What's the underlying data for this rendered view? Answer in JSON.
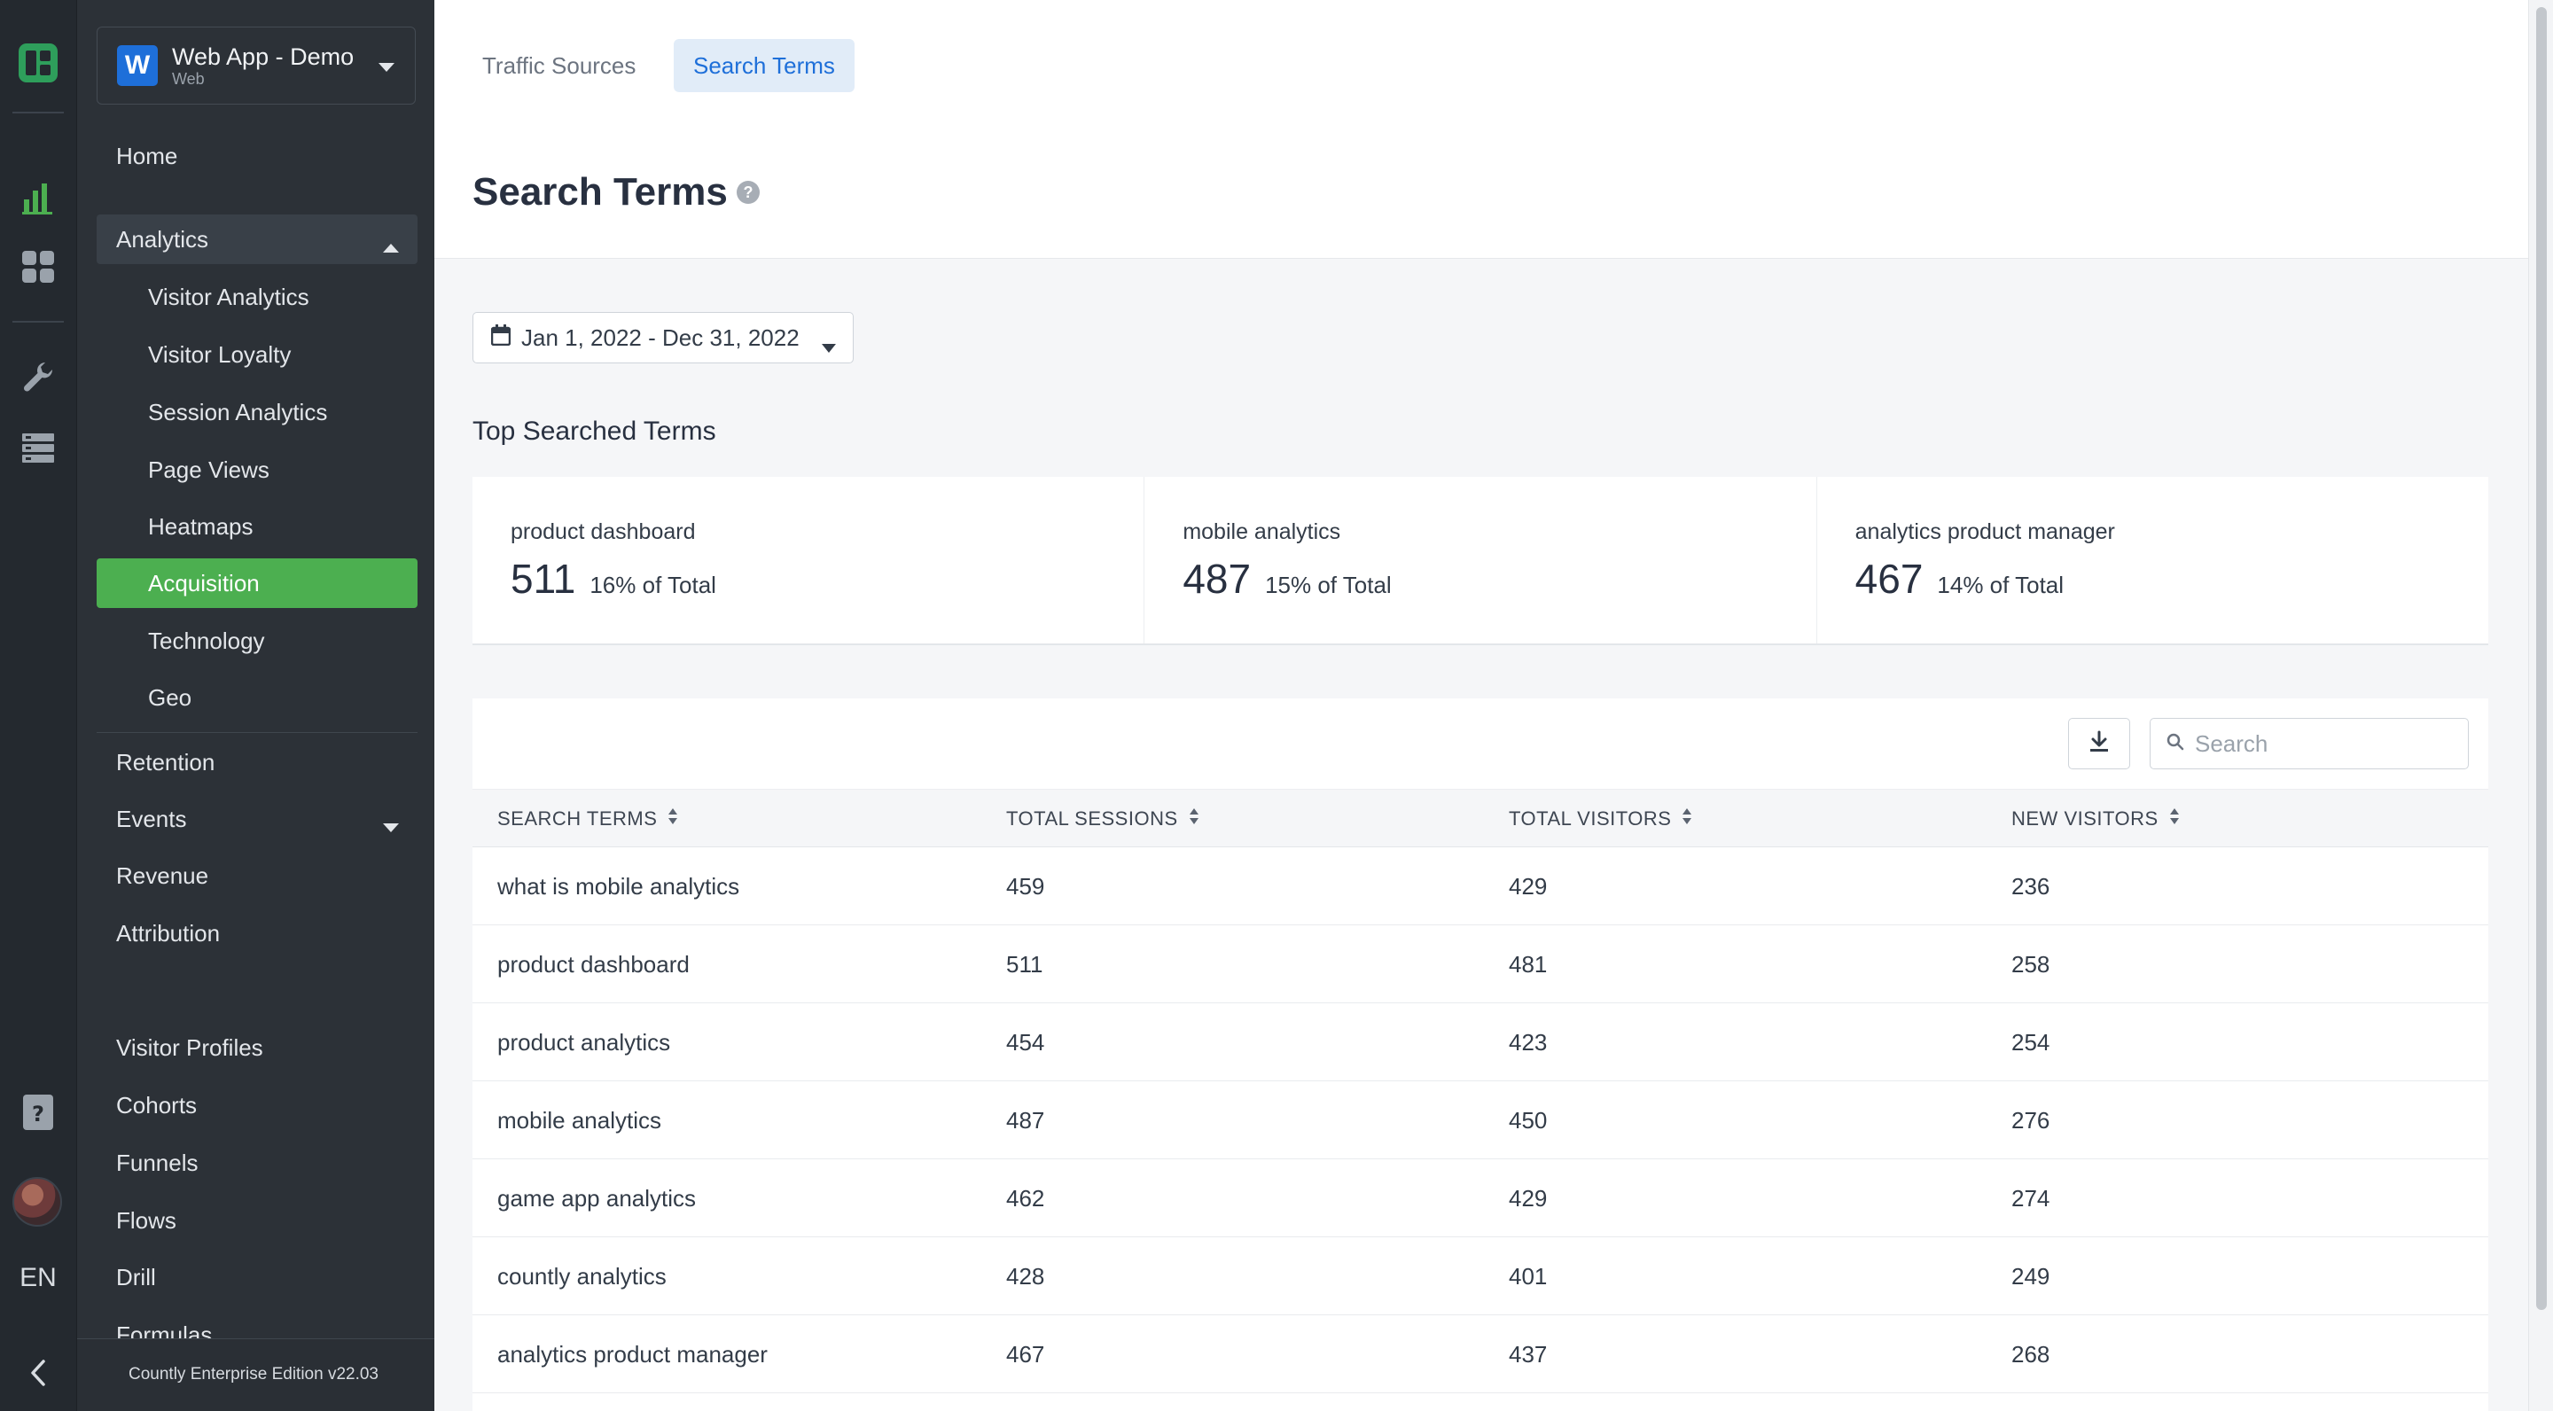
{
  "app": {
    "name": "Web App - Demo",
    "type": "Web",
    "badge": "W",
    "accent": "#4caf50",
    "brand_blue": "#1e6fd9"
  },
  "rail": {
    "icons": [
      "countly-logo-icon",
      "analytics-chart-icon",
      "dashboard-grid-icon",
      "wrench-icon",
      "database-icon",
      "notes-icon",
      "avatar"
    ],
    "language": "EN"
  },
  "sidebar": {
    "items": [
      {
        "label": "Home"
      },
      {
        "label": "Analytics"
      },
      {
        "label": "Visitor Analytics"
      },
      {
        "label": "Visitor Loyalty"
      },
      {
        "label": "Session Analytics"
      },
      {
        "label": "Page Views"
      },
      {
        "label": "Heatmaps"
      },
      {
        "label": "Acquisition"
      },
      {
        "label": "Technology"
      },
      {
        "label": "Geo"
      },
      {
        "label": "Retention"
      },
      {
        "label": "Events"
      },
      {
        "label": "Revenue"
      },
      {
        "label": "Attribution"
      },
      {
        "label": "Visitor Profiles"
      },
      {
        "label": "Cohorts"
      },
      {
        "label": "Funnels"
      },
      {
        "label": "Flows"
      },
      {
        "label": "Drill"
      },
      {
        "label": "Formulas"
      }
    ],
    "active": "Acquisition",
    "version": "Countly Enterprise Edition v22.03"
  },
  "tabs": [
    {
      "label": "Traffic Sources",
      "active": false
    },
    {
      "label": "Search Terms",
      "active": true
    }
  ],
  "page": {
    "title": "Search Terms",
    "help": "?",
    "date_range": "Jan 1, 2022 - Dec 31, 2022",
    "section_title": "Top Searched Terms"
  },
  "top_terms": [
    {
      "term": "product dashboard",
      "value": "511",
      "pct": "16% of Total"
    },
    {
      "term": "mobile analytics",
      "value": "487",
      "pct": "15% of Total"
    },
    {
      "term": "analytics product manager",
      "value": "467",
      "pct": "14% of Total"
    }
  ],
  "table": {
    "search_placeholder": "Search",
    "columns": [
      "SEARCH TERMS",
      "TOTAL SESSIONS",
      "TOTAL VISITORS",
      "NEW VISITORS"
    ],
    "rows": [
      [
        "what is mobile analytics",
        "459",
        "429",
        "236"
      ],
      [
        "product dashboard",
        "511",
        "481",
        "258"
      ],
      [
        "product analytics",
        "454",
        "423",
        "254"
      ],
      [
        "mobile analytics",
        "487",
        "450",
        "276"
      ],
      [
        "game app analytics",
        "462",
        "429",
        "274"
      ],
      [
        "countly analytics",
        "428",
        "401",
        "249"
      ],
      [
        "analytics product manager",
        "467",
        "437",
        "268"
      ]
    ]
  }
}
